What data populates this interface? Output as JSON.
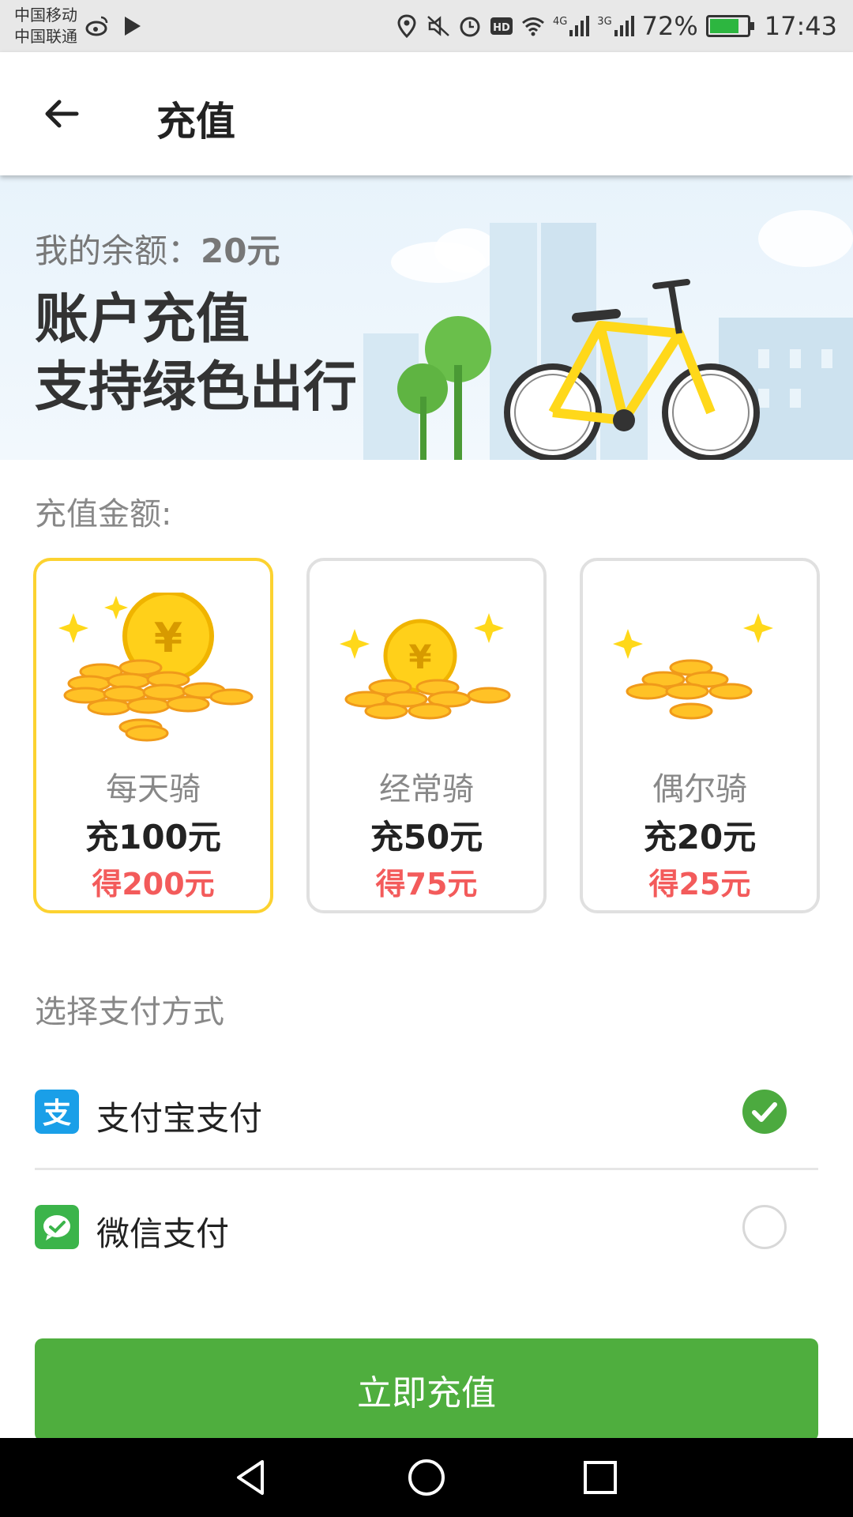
{
  "status_bar": {
    "carrier_1": "中国移动",
    "carrier_2": "中国联通",
    "net_4g": "4G",
    "net_3g": "3G",
    "battery": "72%",
    "battery_level": 0.72,
    "time": "17:43",
    "icons": [
      "weibo-icon",
      "play-icon",
      "location-icon",
      "mute-icon",
      "alarm-icon",
      "hd-icon",
      "wifi-icon",
      "signal-icon",
      "battery-icon"
    ]
  },
  "app_bar": {
    "title": "充值",
    "back_icon": "arrow-left-icon"
  },
  "banner": {
    "balance_label": "我的余额：",
    "balance_value": "20元",
    "slogan_line1": "账户充值",
    "slogan_line2": "支持绿色出行"
  },
  "amount_section": {
    "label": "充值金额:",
    "options": [
      {
        "name": "每天骑",
        "charge": "充100元",
        "get": "得200元",
        "selected": true
      },
      {
        "name": "经常骑",
        "charge": "充50元",
        "get": "得75元",
        "selected": false
      },
      {
        "name": "偶尔骑",
        "charge": "充20元",
        "get": "得25元",
        "selected": false
      }
    ]
  },
  "payment_section": {
    "label": "选择支付方式",
    "methods": [
      {
        "name": "支付宝支付",
        "icon": "alipay-icon",
        "selected": true
      },
      {
        "name": "微信支付",
        "icon": "wechat-icon",
        "selected": false
      }
    ]
  },
  "submit_label": "立即充值",
  "colors": {
    "accent_green": "#4fae3e",
    "selected_border": "#fcd230",
    "bonus_red": "#f35b5b",
    "alipay_blue": "#1a9fe8",
    "wechat_green": "#3bb44a"
  },
  "nav_bar": {
    "icons": [
      "back-triangle-icon",
      "home-circle-icon",
      "recents-square-icon"
    ]
  }
}
